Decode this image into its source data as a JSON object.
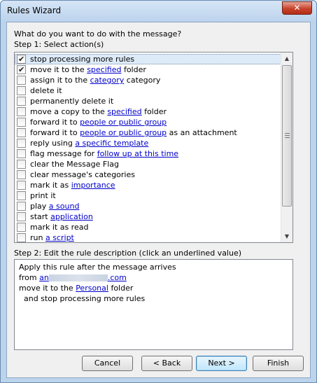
{
  "window": {
    "title": "Rules Wizard",
    "close_glyph": "✕"
  },
  "question": "What do you want to do with the message?",
  "step1": "Step 1: Select action(s)",
  "actions": [
    {
      "checked": true,
      "selected": true,
      "pre": "stop processing more rules",
      "link": "",
      "post": ""
    },
    {
      "checked": true,
      "selected": false,
      "pre": "move it to the ",
      "link": "specified",
      "post": " folder"
    },
    {
      "checked": false,
      "selected": false,
      "pre": "assign it to the ",
      "link": "category",
      "post": " category"
    },
    {
      "checked": false,
      "selected": false,
      "pre": "delete it",
      "link": "",
      "post": ""
    },
    {
      "checked": false,
      "selected": false,
      "pre": "permanently delete it",
      "link": "",
      "post": ""
    },
    {
      "checked": false,
      "selected": false,
      "pre": "move a copy to the ",
      "link": "specified",
      "post": " folder"
    },
    {
      "checked": false,
      "selected": false,
      "pre": "forward it to ",
      "link": "people or public group",
      "post": ""
    },
    {
      "checked": false,
      "selected": false,
      "pre": "forward it to ",
      "link": "people or public group",
      "post": " as an attachment"
    },
    {
      "checked": false,
      "selected": false,
      "pre": "reply using ",
      "link": "a specific template",
      "post": ""
    },
    {
      "checked": false,
      "selected": false,
      "pre": "flag message for ",
      "link": "follow up at this time",
      "post": ""
    },
    {
      "checked": false,
      "selected": false,
      "pre": "clear the Message Flag",
      "link": "",
      "post": ""
    },
    {
      "checked": false,
      "selected": false,
      "pre": "clear message's categories",
      "link": "",
      "post": ""
    },
    {
      "checked": false,
      "selected": false,
      "pre": "mark it as ",
      "link": "importance",
      "post": ""
    },
    {
      "checked": false,
      "selected": false,
      "pre": "print it",
      "link": "",
      "post": ""
    },
    {
      "checked": false,
      "selected": false,
      "pre": "play ",
      "link": "a sound",
      "post": ""
    },
    {
      "checked": false,
      "selected": false,
      "pre": "start ",
      "link": "application",
      "post": ""
    },
    {
      "checked": false,
      "selected": false,
      "pre": "mark it as read",
      "link": "",
      "post": ""
    },
    {
      "checked": false,
      "selected": false,
      "pre": "run ",
      "link": "a script",
      "post": ""
    }
  ],
  "step2": "Step 2: Edit the rule description (click an underlined value)",
  "description": {
    "line1": "Apply this rule after the message arrives",
    "line2_pre": "from ",
    "line2_link_a": "an",
    "line2_link_b": ".com",
    "line3_pre": "move it to the ",
    "line3_link": "Personal",
    "line3_post": " folder",
    "line4": "  and stop processing more rules"
  },
  "buttons": {
    "cancel": "Cancel",
    "back": "< Back",
    "next": "Next >",
    "finish": "Finish"
  }
}
